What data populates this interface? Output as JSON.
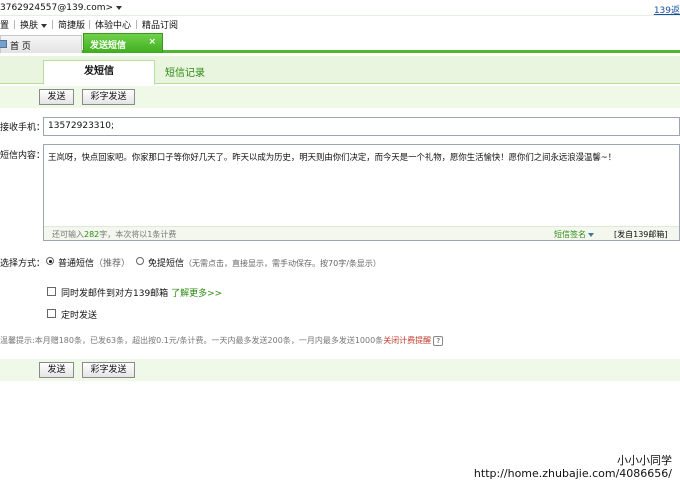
{
  "topbar": {
    "account": "3762924557@139.com>",
    "right_link": "139返"
  },
  "menubar": {
    "items": [
      "置",
      "换肤",
      "简捷版",
      "体验中心",
      "精品订阅"
    ]
  },
  "tabs": {
    "home": "首 页",
    "active": "发送短信",
    "close": "×"
  },
  "subtabs": {
    "send": "发短信",
    "records": "短信记录"
  },
  "toolbar": {
    "send": "发送",
    "color_send": "彩字发送"
  },
  "form": {
    "recipient_label": "接收手机：",
    "recipient_value": "13572923310;",
    "content_label": "短信内容：",
    "content_text": "王岚呀，快点回家吧。你家那口子等你好几天了。昨天以成为历史，明天则由你们决定，而今天是一个礼物，愿你生活愉快！愿你们之间永远浪漫温馨~！",
    "remaining_prefix": "还可输入",
    "remaining_count": "282",
    "remaining_suffix": "字，本次将以1条计费",
    "signature": "短信签名",
    "sender_tag": "[发自139邮箱]",
    "mode_label": "选择方式：",
    "mode_normal": "普通短信",
    "mode_normal_hint": "（推荐）",
    "mode_flash": "免提短信",
    "mode_flash_hint": "（无需点击，直接显示，需手动保存。按70字/条显示）",
    "copy_mail_label": "同时发邮件到对方139邮箱",
    "learn_more": "了解更多>>",
    "scheduled_label": "定时发送"
  },
  "tip": {
    "text": "温馨提示:本月赠180条，已发63条，超出按0.1元/条计费。一天内最多发送200条，一月内最多发送1000条",
    "action": "关闭计费提醒",
    "help_icon": "?"
  },
  "watermark": {
    "name": "小小小同学",
    "url": "http://home.zhubajie.com/4086656/"
  }
}
